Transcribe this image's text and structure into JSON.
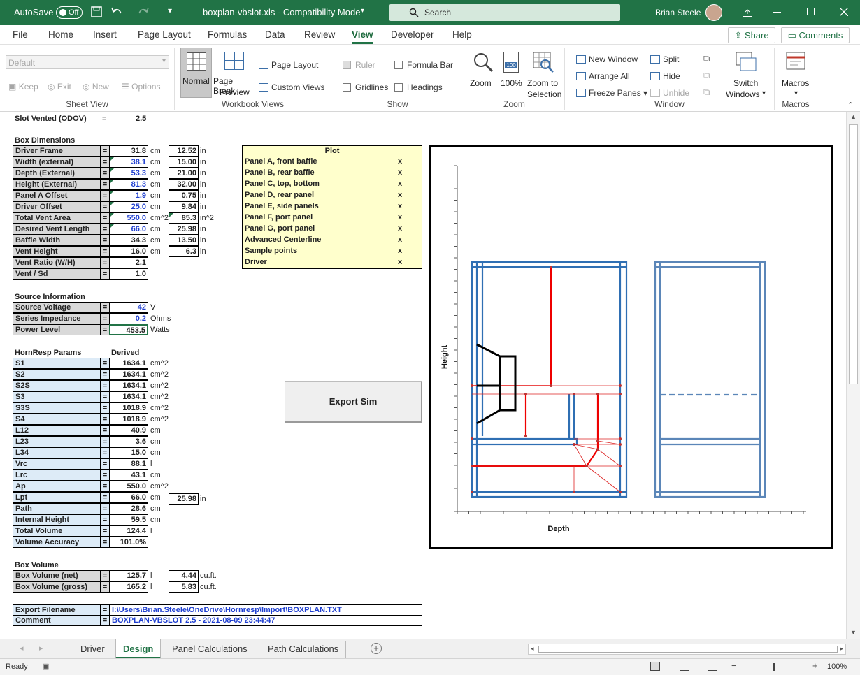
{
  "titlebar": {
    "autosave": "AutoSave",
    "autosave_state": "Off",
    "filename": "boxplan-vbslot.xls - Compatibility Mode",
    "search_placeholder": "Search",
    "user": "Brian Steele"
  },
  "tabs": [
    "File",
    "Home",
    "Insert",
    "Page Layout",
    "Formulas",
    "Data",
    "Review",
    "View",
    "Developer",
    "Help"
  ],
  "active_tab": "View",
  "share": "Share",
  "comments": "Comments",
  "ribbon": {
    "sheet_view": {
      "label": "Sheet View",
      "dropdown": "Default",
      "keep": "Keep",
      "exit": "Exit",
      "new": "New",
      "options": "Options"
    },
    "workbook_views": {
      "label": "Workbook Views",
      "normal": "Normal",
      "page_break": "Page Break",
      "preview": "Preview",
      "page_layout": "Page Layout",
      "custom_views": "Custom Views"
    },
    "show": {
      "label": "Show",
      "ruler": "Ruler",
      "formula_bar": "Formula Bar",
      "gridlines": "Gridlines",
      "headings": "Headings"
    },
    "zoom": {
      "label": "Zoom",
      "zoom": "Zoom",
      "zoom_icon": "100",
      "pct": "100%",
      "zoom_to": "Zoom to",
      "selection": "Selection"
    },
    "window": {
      "label": "Window",
      "new_window": "New Window",
      "arrange_all": "Arrange All",
      "freeze_panes": "Freeze Panes",
      "split": "Split",
      "hide": "Hide",
      "unhide": "Unhide",
      "switch": "Switch",
      "windows": "Windows"
    },
    "macros": {
      "label": "Macros",
      "macros": "Macros"
    }
  },
  "sheet": {
    "slot_vented_label": "Slot Vented (ODOV)",
    "slot_eq": "=",
    "slot_value": "2.5",
    "box_dimensions_title": "Box Dimensions",
    "box_dims": [
      {
        "label": "Driver Frame",
        "value": "31.8",
        "unit": "cm",
        "v2": "12.52",
        "u2": "in",
        "blue": false
      },
      {
        "label": "Width (external)",
        "value": "38.1",
        "unit": "cm",
        "v2": "15.00",
        "u2": "in",
        "blue": true
      },
      {
        "label": "Depth (External)",
        "value": "53.3",
        "unit": "cm",
        "v2": "21.00",
        "u2": "in",
        "blue": true
      },
      {
        "label": "Height (External)",
        "value": "81.3",
        "unit": "cm",
        "v2": "32.00",
        "u2": "in",
        "blue": true
      },
      {
        "label": "Panel A Offset",
        "value": "1.9",
        "unit": "cm",
        "v2": "0.75",
        "u2": "in",
        "blue": true
      },
      {
        "label": "Driver Offset",
        "value": "25.0",
        "unit": "cm",
        "v2": "9.84",
        "u2": "in",
        "blue": true
      },
      {
        "label": "Total Vent Area",
        "value": "550.0",
        "unit": "cm^2",
        "v2": "85.3",
        "u2": "in^2",
        "blue": true
      },
      {
        "label": "Desired Vent Length",
        "value": "66.0",
        "unit": "cm",
        "v2": "25.98",
        "u2": "in",
        "blue": true
      },
      {
        "label": "Baffle Width",
        "value": "34.3",
        "unit": "cm",
        "v2": "13.50",
        "u2": "in",
        "blue": false
      },
      {
        "label": "Vent Height",
        "value": "16.0",
        "unit": "cm",
        "v2": "6.3",
        "u2": "in",
        "blue": false
      },
      {
        "label": "Vent Ratio (W/H)",
        "value": "2.1",
        "unit": "",
        "v2": "",
        "u2": "",
        "blue": false
      },
      {
        "label": "Vent / Sd",
        "value": "1.0",
        "unit": "",
        "v2": "",
        "u2": "",
        "blue": false
      }
    ],
    "source_title": "Source Information",
    "source": [
      {
        "label": "Source Voltage",
        "value": "42",
        "unit": "V",
        "blue": true
      },
      {
        "label": "Series Impedance",
        "value": "0.2",
        "unit": "Ohms",
        "blue": true
      },
      {
        "label": "Power Level",
        "value": "453.5",
        "unit": "Watts",
        "blue": false
      }
    ],
    "hornresp_title": "HornResp Params",
    "derived_title": "Derived",
    "hornresp": [
      {
        "label": "S1",
        "value": "1634.1",
        "unit": "cm^2"
      },
      {
        "label": "S2",
        "value": "1634.1",
        "unit": "cm^2"
      },
      {
        "label": "S2S",
        "value": "1634.1",
        "unit": "cm^2"
      },
      {
        "label": "S3",
        "value": "1634.1",
        "unit": "cm^2"
      },
      {
        "label": "S3S",
        "value": "1018.9",
        "unit": "cm^2"
      },
      {
        "label": "S4",
        "value": "1018.9",
        "unit": "cm^2"
      },
      {
        "label": "L12",
        "value": "40.9",
        "unit": "cm"
      },
      {
        "label": "L23",
        "value": "3.6",
        "unit": "cm"
      },
      {
        "label": "L34",
        "value": "15.0",
        "unit": "cm"
      },
      {
        "label": "Vrc",
        "value": "88.1",
        "unit": "l"
      },
      {
        "label": "Lrc",
        "value": "43.1",
        "unit": "cm"
      },
      {
        "label": "Ap",
        "value": "550.0",
        "unit": "cm^2"
      },
      {
        "label": "Lpt",
        "value": "66.0",
        "unit": "cm"
      },
      {
        "label": "Path",
        "value": "28.6",
        "unit": "cm"
      },
      {
        "label": "Internal Height",
        "value": "59.5",
        "unit": "cm"
      },
      {
        "label": "Total Volume",
        "value": "124.4",
        "unit": "l"
      },
      {
        "label": "Volume Accuracy",
        "value": "101.0%",
        "unit": ""
      }
    ],
    "lpt_in": "25.98",
    "lpt_in_unit": "in",
    "box_volume_title": "Box Volume",
    "box_volume": [
      {
        "label": "Box Volume (net)",
        "value": "125.7",
        "unit": "l",
        "v2": "4.44",
        "u2": "cu.ft."
      },
      {
        "label": "Box Volume (gross)",
        "value": "165.2",
        "unit": "l",
        "v2": "5.83",
        "u2": "cu.ft."
      }
    ],
    "export_filename_label": "Export Filename",
    "export_filename": "I:\\Users\\Brian.Steele\\OneDrive\\Hornresp\\Import\\BOXPLAN.TXT",
    "comment_label": "Comment",
    "comment": "BOXPLAN-VBSLOT 2.5 - 2021-08-09 23:44:47",
    "eq": "=",
    "plot_header": "Plot",
    "plot_items": [
      {
        "label": "Panel A, front baffle",
        "mark": "x"
      },
      {
        "label": "Panel B, rear baffle",
        "mark": "x"
      },
      {
        "label": "Panel C, top, bottom",
        "mark": "x"
      },
      {
        "label": "Panel D, rear panel",
        "mark": "x"
      },
      {
        "label": "Panel E, side panels",
        "mark": "x"
      },
      {
        "label": "Panel F, port panel",
        "mark": "x"
      },
      {
        "label": "Panel G, port panel",
        "mark": "x"
      },
      {
        "label": "Advanced Centerline",
        "mark": "x"
      },
      {
        "label": "Sample points",
        "mark": "x"
      },
      {
        "label": "Driver",
        "mark": "x"
      }
    ],
    "export_sim": "Export Sim",
    "chart_ylabel": "Height",
    "chart_xlabel": "Depth"
  },
  "sheet_tabs": [
    "Driver",
    "Design",
    "Panel Calculations",
    "Path Calculations"
  ],
  "active_sheet": "Design",
  "status": {
    "ready": "Ready",
    "zoom": "100%"
  }
}
